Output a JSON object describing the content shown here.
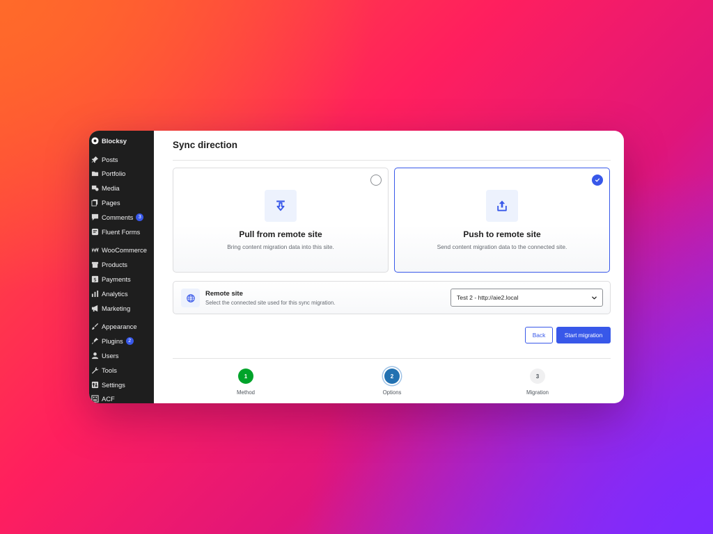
{
  "sidebar": {
    "items": [
      {
        "id": "blocksy",
        "label": "Blocksy",
        "icon": "blocksy-logo-icon",
        "gap": false,
        "bold": true
      },
      {
        "id": "posts",
        "label": "Posts",
        "icon": "pin-icon",
        "gap": true
      },
      {
        "id": "portfolio",
        "label": "Portfolio",
        "icon": "folder-icon",
        "gap": false
      },
      {
        "id": "media",
        "label": "Media",
        "icon": "media-icon",
        "gap": false
      },
      {
        "id": "pages",
        "label": "Pages",
        "icon": "pages-icon",
        "gap": false
      },
      {
        "id": "comments",
        "label": "Comments",
        "icon": "comment-icon",
        "gap": false,
        "badge": "3"
      },
      {
        "id": "fluent-forms",
        "label": "Fluent Forms",
        "icon": "form-icon",
        "gap": false
      },
      {
        "id": "woocommerce",
        "label": "WooCommerce",
        "icon": "woo-icon",
        "gap": true
      },
      {
        "id": "products",
        "label": "Products",
        "icon": "box-icon",
        "gap": false
      },
      {
        "id": "payments",
        "label": "Payments",
        "icon": "dollar-icon",
        "gap": false
      },
      {
        "id": "analytics",
        "label": "Analytics",
        "icon": "bar-chart-icon",
        "gap": false
      },
      {
        "id": "marketing",
        "label": "Marketing",
        "icon": "megaphone-icon",
        "gap": false
      },
      {
        "id": "appearance",
        "label": "Appearance",
        "icon": "brush-icon",
        "gap": true
      },
      {
        "id": "plugins",
        "label": "Plugins",
        "icon": "plug-icon",
        "gap": false,
        "badge": "2"
      },
      {
        "id": "users",
        "label": "Users",
        "icon": "user-icon",
        "gap": false
      },
      {
        "id": "tools",
        "label": "Tools",
        "icon": "wrench-icon",
        "gap": false
      },
      {
        "id": "settings",
        "label": "Settings",
        "icon": "settings-icon",
        "gap": false
      },
      {
        "id": "acf",
        "label": "ACF",
        "icon": "acf-icon",
        "gap": false
      }
    ]
  },
  "main": {
    "title": "Sync direction",
    "options": [
      {
        "title": "Pull from remote site",
        "description": "Bring content migration data into this site.",
        "icon": "download-arrow-icon",
        "selected": false
      },
      {
        "title": "Push to remote site",
        "description": "Send content migration data to the connected site.",
        "icon": "upload-arrow-icon",
        "selected": true
      }
    ],
    "remote_site": {
      "title": "Remote site",
      "description": "Select the connected site used for this sync migration.",
      "selected_value": "Test 2 - http://aie2.local",
      "icon": "globe-icon"
    },
    "buttons": {
      "back_label": "Back",
      "start_label": "Start migration"
    },
    "steps": [
      {
        "number": "1",
        "label": "Method",
        "status": "complete"
      },
      {
        "number": "2",
        "label": "Options",
        "status": "current"
      },
      {
        "number": "3",
        "label": "Migration",
        "status": "upcoming"
      }
    ]
  },
  "colors": {
    "accent": "#3858e9",
    "sidebar_bg": "#1e1e1e",
    "step_complete": "#00a32a",
    "step_current": "#2271b1"
  }
}
